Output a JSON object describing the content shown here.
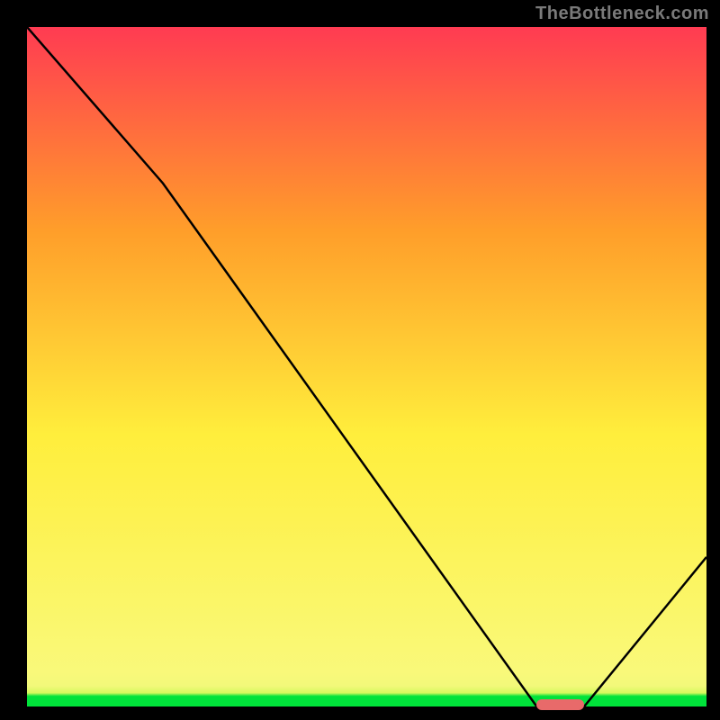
{
  "watermark": "TheBottleneck.com",
  "chart_data": {
    "type": "line",
    "title": "",
    "xlabel": "",
    "ylabel": "",
    "xlim": [
      0,
      100
    ],
    "ylim": [
      0,
      100
    ],
    "x": [
      0,
      20,
      75,
      82,
      100
    ],
    "values": [
      100,
      77,
      0,
      0,
      22
    ],
    "curve_note": "piecewise: linear drop 0-20, steeper linear 20-75, flat minimum 75-82, linear rise 82-100",
    "marker": {
      "x_start": 75,
      "x_end": 82,
      "y": 0
    },
    "gradient_stops": [
      {
        "pos": 0.0,
        "color": "#00e33a"
      },
      {
        "pos": 0.015,
        "color": "#00e33a"
      },
      {
        "pos": 0.02,
        "color": "#d6f95c"
      },
      {
        "pos": 0.03,
        "color": "#f2f97a"
      },
      {
        "pos": 0.05,
        "color": "#f9f97a"
      },
      {
        "pos": 0.4,
        "color": "#ffee3c"
      },
      {
        "pos": 0.7,
        "color": "#ff9e2a"
      },
      {
        "pos": 1.0,
        "color": "#ff3b52"
      }
    ]
  }
}
